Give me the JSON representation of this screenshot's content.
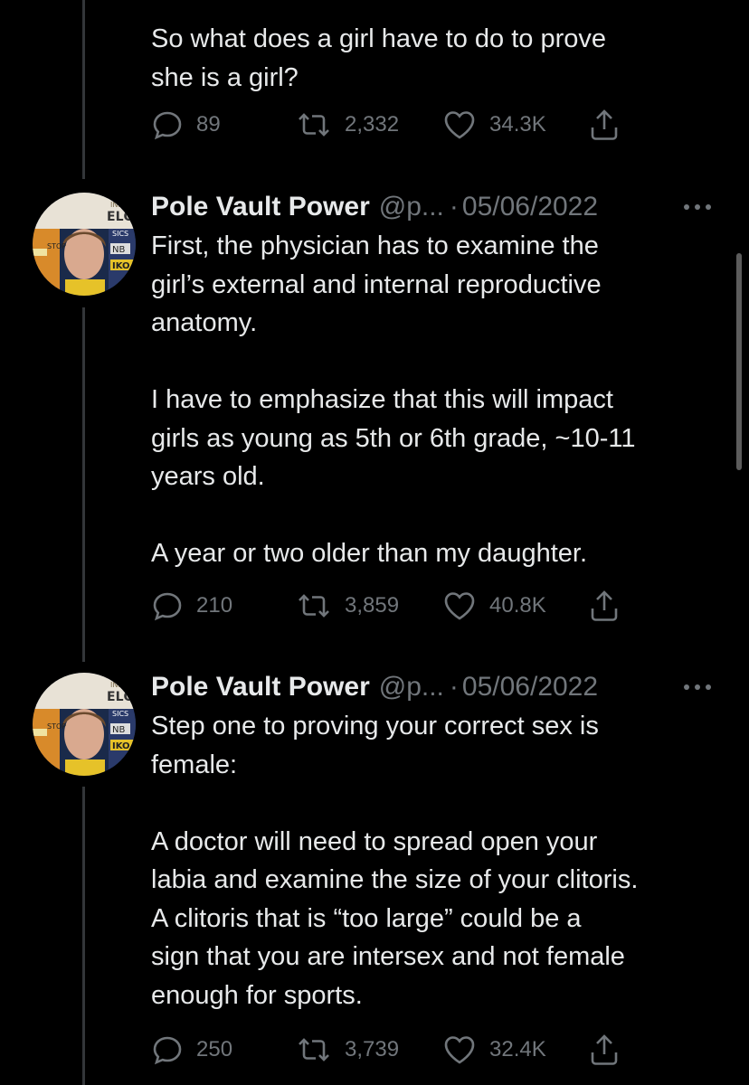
{
  "tweets": [
    {
      "name": "",
      "handle": "",
      "date": "",
      "text": "So what does a girl have to do to prove\nshe is a girl?",
      "replies": "89",
      "retweets": "2,332",
      "likes": "34.3K"
    },
    {
      "name": "Pole Vault Power",
      "handle": "@p...",
      "separator": "·",
      "date": "05/06/2022",
      "text": "First, the physician has to examine the\ngirl’s external and internal reproductive\nanatomy.\n\nI have to emphasize that this will impact\ngirls as young as 5th or 6th grade, ~10-11\nyears old.\n\nA year or two older than my daughter.",
      "replies": "210",
      "retweets": "3,859",
      "likes": "40.8K",
      "avatar_text": [
        "ELGI",
        "NB",
        "IKO",
        "STOP",
        "SICS"
      ]
    },
    {
      "name": "Pole Vault Power",
      "handle": "@p...",
      "separator": "·",
      "date": "05/06/2022",
      "text": "Step one to proving your correct sex is\nfemale:\n\nA doctor will need to spread open your\nlabia and examine the size of your clitoris.\nA clitoris that is “too large” could be a\nsign that you are intersex and not female\nenough for sports.",
      "replies": "250",
      "retweets": "3,739",
      "likes": "32.4K",
      "avatar_text": [
        "ELGI",
        "NB",
        "IKO",
        "STOP",
        "SICS"
      ]
    }
  ],
  "icons": {
    "reply": "reply-icon",
    "retweet": "retweet-icon",
    "like": "heart-icon",
    "share": "share-icon",
    "more": "more-icon"
  },
  "colors": {
    "background": "#000000",
    "text": "#e7e9ea",
    "muted": "#71767b",
    "thread_line": "#333639"
  }
}
